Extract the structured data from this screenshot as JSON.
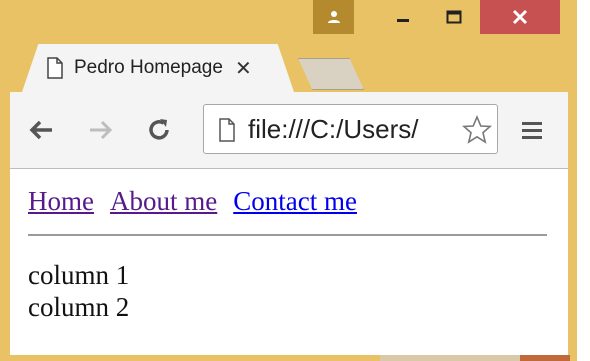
{
  "tab": {
    "title": "Pedro Homepage",
    "close_icon": "close-icon",
    "page_icon": "page-icon"
  },
  "toolbar": {
    "url": "file:///C:/Users/",
    "back_icon": "back-arrow-icon",
    "forward_icon": "forward-arrow-icon",
    "reload_icon": "reload-icon",
    "star_icon": "star-icon",
    "menu_icon": "hamburger-menu-icon"
  },
  "window_controls": {
    "profile_icon": "profile-icon",
    "minimize_icon": "minimize-icon",
    "maximize_icon": "maximize-icon",
    "close_icon": "close-icon"
  },
  "page": {
    "nav": {
      "home": "Home",
      "about": "About me",
      "contact": "Contact me"
    },
    "columns": [
      "column 1",
      "column 2"
    ]
  },
  "colors": {
    "frame": "#e8c264",
    "close_button": "#c75050",
    "visited_link": "#551a8b",
    "unvisited_link": "#0000ee"
  }
}
